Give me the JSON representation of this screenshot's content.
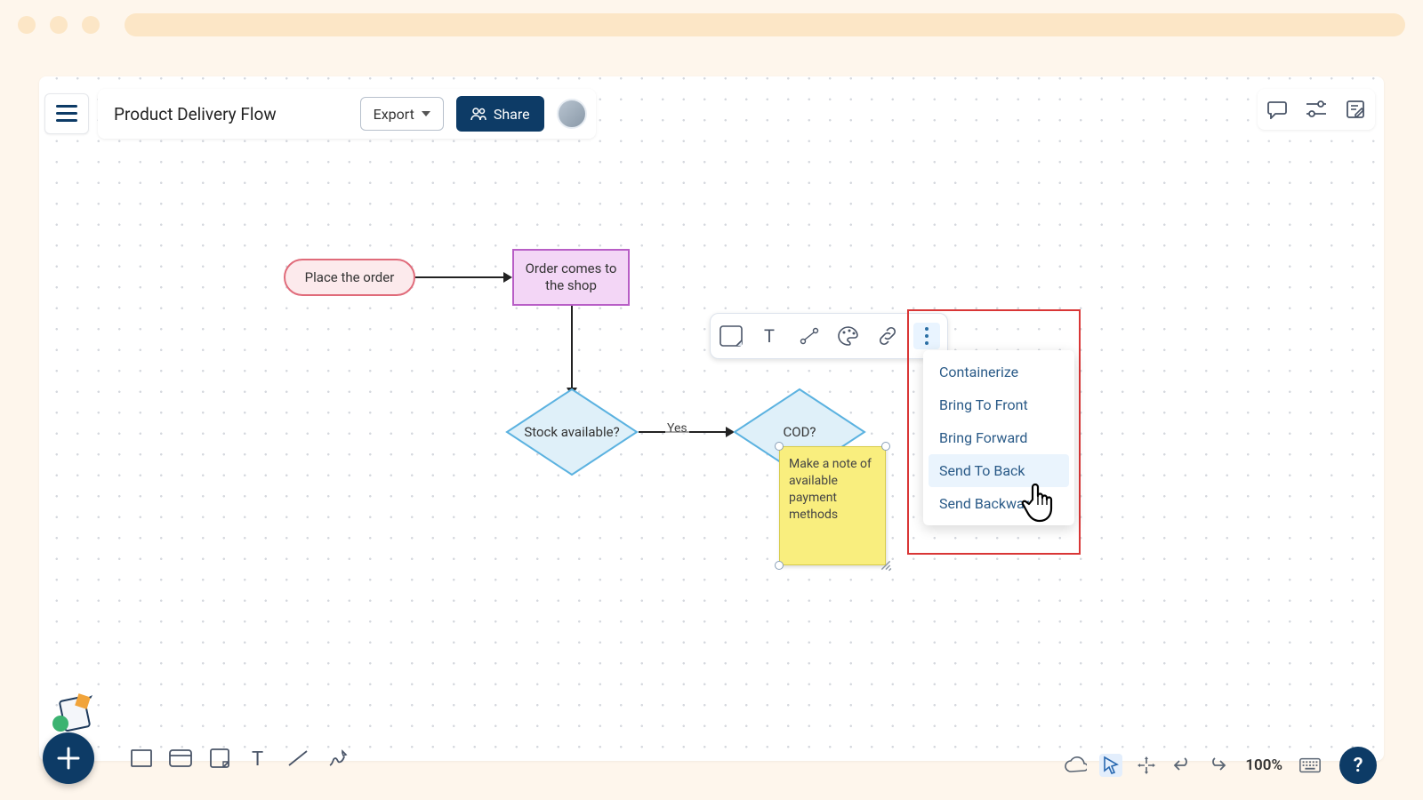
{
  "header": {
    "title": "Product Delivery Flow",
    "export_label": "Export",
    "share_label": "Share"
  },
  "flowchart": {
    "start": "Place the order",
    "process1": "Order comes to the shop",
    "decision1": "Stock available?",
    "edge_yes": "Yes",
    "decision2": "COD?",
    "sticky_note": "Make a note of available payment methods"
  },
  "context_menu": {
    "items": [
      "Containerize",
      "Bring To Front",
      "Bring Forward",
      "Send To Back",
      "Send Backward"
    ],
    "hovered_index": 3
  },
  "status": {
    "zoom": "100%"
  }
}
